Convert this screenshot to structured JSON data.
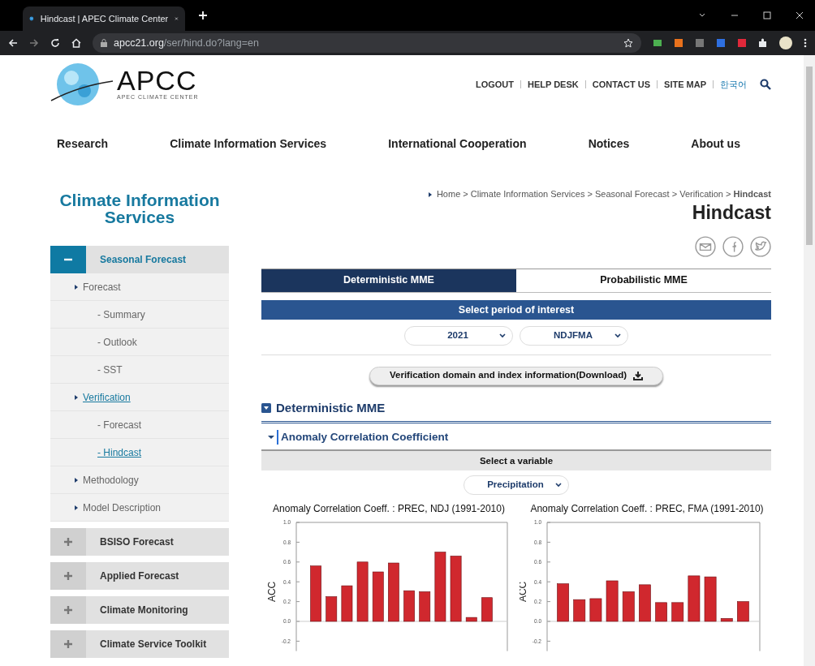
{
  "browser": {
    "tab_title": "Hindcast | APEC Climate Center",
    "url_host": "apcc21.org",
    "url_path": "/ser/hind.do?lang=en"
  },
  "header": {
    "logo": {
      "name": "APCC",
      "tagline": "APEC CLIMATE CENTER"
    },
    "top_links": [
      {
        "label": "LOGOUT",
        "kind": "link"
      },
      {
        "label": "HELP DESK",
        "kind": "link"
      },
      {
        "label": "CONTACT US",
        "kind": "link"
      },
      {
        "label": "SITE MAP",
        "kind": "link"
      },
      {
        "label": "한국어",
        "kind": "language"
      }
    ]
  },
  "main_nav": [
    "Research",
    "Climate Information Services",
    "International Cooperation",
    "Notices",
    "About us"
  ],
  "sidebar": {
    "title": "Climate Information Services",
    "groups": [
      {
        "label": "Seasonal Forecast",
        "expanded": true,
        "children": [
          {
            "label": "Forecast",
            "selected": false,
            "children": [
              {
                "label": "- Summary",
                "selected": false
              },
              {
                "label": "- Outlook",
                "selected": false
              },
              {
                "label": "- SST",
                "selected": false
              }
            ]
          },
          {
            "label": "Verification",
            "selected": true,
            "children": [
              {
                "label": "- Forecast",
                "selected": false
              },
              {
                "label": "- Hindcast",
                "selected": true
              }
            ]
          },
          {
            "label": "Methodology",
            "selected": false
          },
          {
            "label": "Model Description",
            "selected": false
          }
        ]
      },
      {
        "label": "BSISO Forecast",
        "expanded": false
      },
      {
        "label": "Applied Forecast",
        "expanded": false
      },
      {
        "label": "Climate Monitoring",
        "expanded": false
      },
      {
        "label": "Climate Service Toolkit",
        "expanded": false
      }
    ]
  },
  "breadcrumb": "Home > Climate Information Services > Seasonal Forecast > Verification > **Hindcast**",
  "page_title": "Hindcast",
  "tabs": [
    {
      "label": "Deterministic MME",
      "selected": true
    },
    {
      "label": "Probabilistic MME",
      "selected": false
    }
  ],
  "period": {
    "heading": "Select period of interest",
    "selects": [
      {
        "value": "2021"
      },
      {
        "value": "NDJFMA"
      }
    ]
  },
  "download_button": "Verification domain and index information(Download)",
  "section": {
    "title": "Deterministic MME",
    "expanded": true,
    "subsection": {
      "title": "Anomaly Correlation Coefficient",
      "expanded": true,
      "variable_heading": "Select a variable",
      "variable_select": "Precipitation",
      "charts": [
        {
          "chart_data": {
            "type": "bar",
            "title": "Anomaly Correlation Coeff. : PREC, NDJ (1991-2010)",
            "ylabel": "ACC",
            "ylim": [
              -0.3,
              1.0
            ],
            "yticks": [
              {
                "value": -0.2,
                "label": "-0.2"
              },
              {
                "value": 0,
                "label": "0.0"
              },
              {
                "value": 0.2,
                "label": "0.2"
              },
              {
                "value": 0.4,
                "label": "0.4"
              },
              {
                "value": 0.6,
                "label": "0.6"
              },
              {
                "value": 0.8,
                "label": "0.8"
              },
              {
                "value": 1,
                "label": "1.0"
              }
            ],
            "series": [
              {
                "color": "#d0282e",
                "values": [
                  0.56,
                  0.25,
                  0.36,
                  0.6,
                  0.5,
                  0.59,
                  0.31,
                  0.3,
                  0.7,
                  0.66,
                  0.04,
                  0.24
                ]
              }
            ]
          }
        },
        {
          "chart_data": {
            "type": "bar",
            "title": "Anomaly Correlation Coeff. : PREC, FMA (1991-2010)",
            "ylabel": "ACC",
            "ylim": [
              -0.3,
              1.0
            ],
            "yticks": [
              {
                "value": -0.2,
                "label": "-0.2"
              },
              {
                "value": 0,
                "label": "0.0"
              },
              {
                "value": 0.2,
                "label": "0.2"
              },
              {
                "value": 0.4,
                "label": "0.4"
              },
              {
                "value": 0.6,
                "label": "0.6"
              },
              {
                "value": 0.8,
                "label": "0.8"
              },
              {
                "value": 1,
                "label": "1.0"
              }
            ],
            "series": [
              {
                "color": "#d0282e",
                "values": [
                  0.38,
                  0.22,
                  0.23,
                  0.41,
                  0.3,
                  0.37,
                  0.19,
                  0.19,
                  0.46,
                  0.45,
                  0.03,
                  0.2
                ]
              }
            ]
          }
        }
      ]
    }
  }
}
